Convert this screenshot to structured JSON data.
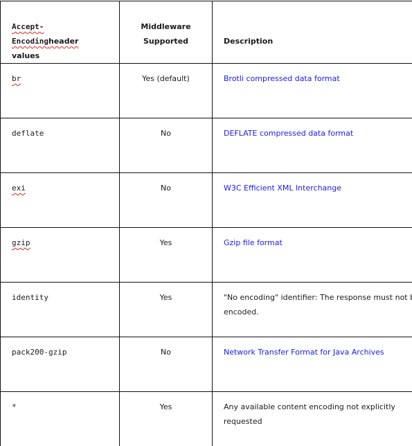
{
  "table": {
    "headers": {
      "col1_line1": "Accept-Encoding",
      "col1_line1b": "header",
      "col1_line2": "values",
      "col2_line1": "Middleware",
      "col2_line2": "Supported",
      "col3": "Description"
    },
    "link_color": "#1a1aee",
    "rows": [
      {
        "value": "br",
        "spellcheck": true,
        "supported": "Yes (default)",
        "description": "Brotli compressed data format",
        "is_link": true
      },
      {
        "value": "deflate",
        "spellcheck": false,
        "supported": "No",
        "description": "DEFLATE compressed data format",
        "is_link": true
      },
      {
        "value": "exi",
        "spellcheck": true,
        "supported": "No",
        "description": "W3C Efficient XML Interchange",
        "is_link": true
      },
      {
        "value": "gzip",
        "spellcheck": true,
        "supported": "Yes",
        "description": "Gzip file format",
        "is_link": true
      },
      {
        "value": "identity",
        "spellcheck": false,
        "supported": "Yes",
        "description": "\"No encoding\" identifier: The response must not be encoded.",
        "is_link": false
      },
      {
        "value": "pack200-gzip",
        "spellcheck": false,
        "supported": "No",
        "description": "Network Transfer Format for Java Archives",
        "is_link": true
      },
      {
        "value": "*",
        "spellcheck": false,
        "supported": "Yes",
        "description": "Any available content encoding not explicitly requested",
        "is_link": false
      }
    ]
  }
}
